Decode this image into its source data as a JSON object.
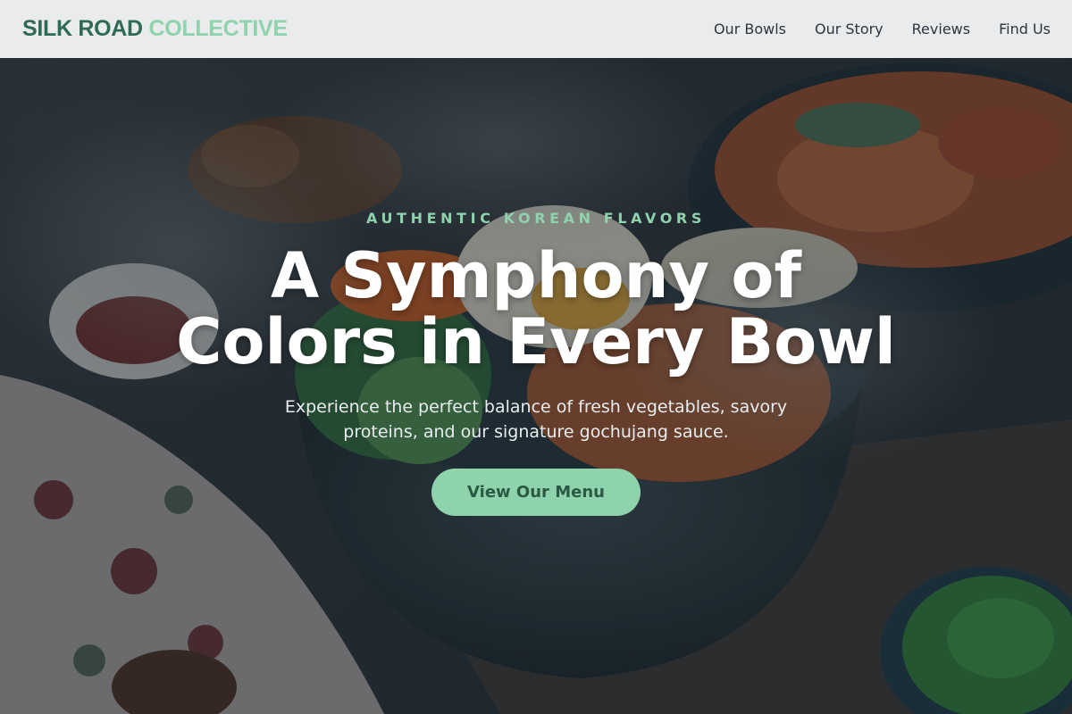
{
  "brand": {
    "part1": "SILK ROAD",
    "part2": "COLLECTIVE"
  },
  "nav": {
    "items": [
      {
        "label": "Our Bowls"
      },
      {
        "label": "Our Story"
      },
      {
        "label": "Reviews"
      },
      {
        "label": "Find Us"
      }
    ]
  },
  "hero": {
    "eyebrow": "AUTHENTIC KOREAN FLAVORS",
    "headline_line1": "A Symphony of",
    "headline_line2": "Colors in Every Bowl",
    "subtitle": "Experience the perfect balance of fresh vegetables, savory proteins, and our signature gochujang sauce.",
    "cta_label": "View Our Menu"
  },
  "colors": {
    "brand_dark": "#2f6b52",
    "accent_mint": "#8fd3ad",
    "nav_bg": "#f4f5f7",
    "cta_text": "#2a5a44"
  }
}
